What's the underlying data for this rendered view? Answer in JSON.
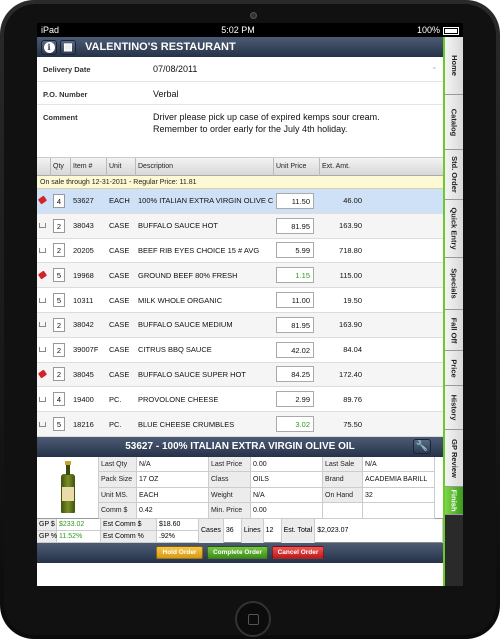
{
  "status_bar": {
    "carrier": "iPad",
    "time": "5:02 PM",
    "battery": "100%"
  },
  "header": {
    "title": "VALENTINO'S RESTAURANT",
    "info_icon": "info-icon",
    "calculator_icon": "calculator-icon"
  },
  "form": {
    "delivery_date_label": "Delivery Date",
    "delivery_date": "07/08/2011",
    "po_label": "P.O. Number",
    "po": "Verbal",
    "comment_label": "Comment",
    "comment": "Driver please pick up case of expired kemps sour cream. Remember to order early for the July 4th holiday."
  },
  "grid": {
    "headers": {
      "qty": "Qty",
      "item": "Item #",
      "unit": "Unit",
      "desc": "Description",
      "price": "Unit Price",
      "ext": "Ext. Amt."
    },
    "on_sale_note": "On sale through 12-31-2011 - Regular Price: 11.81",
    "rows": [
      {
        "icon": "tag",
        "qty": "4",
        "item": "53627",
        "unit": "EACH",
        "desc": "100% ITALIAN EXTRA VIRGIN OLIVE C",
        "price": "11.50",
        "price_green": false,
        "ext": "46.00",
        "selected": true
      },
      {
        "icon": "cart",
        "qty": "2",
        "item": "38043",
        "unit": "CASE",
        "desc": "BUFFALO SAUCE HOT",
        "price": "81.95",
        "price_green": false,
        "ext": "163.90"
      },
      {
        "icon": "cart",
        "qty": "2",
        "item": "20205",
        "unit": "CASE",
        "desc": "BEEF RIB EYES CHOICE 15 # AVG",
        "price": "5.99",
        "price_green": false,
        "ext": "718.80"
      },
      {
        "icon": "tag",
        "qty": "5",
        "item": "19968",
        "unit": "CASE",
        "desc": "GROUND BEEF 80% FRESH",
        "price": "1.15",
        "price_green": true,
        "ext": "115.00"
      },
      {
        "icon": "cart",
        "qty": "5",
        "item": "10311",
        "unit": "CASE",
        "desc": "MILK WHOLE ORGANIC",
        "price": "11.00",
        "price_green": false,
        "ext": "19.50"
      },
      {
        "icon": "cart",
        "qty": "2",
        "item": "38042",
        "unit": "CASE",
        "desc": "BUFFALO SAUCE MEDIUM",
        "price": "81.95",
        "price_green": false,
        "ext": "163.90"
      },
      {
        "icon": "cart",
        "qty": "2",
        "item": "39007F",
        "unit": "CASE",
        "desc": "CITRUS BBQ SAUCE",
        "price": "42.02",
        "price_green": false,
        "ext": "84.04"
      },
      {
        "icon": "tag",
        "qty": "2",
        "item": "38045",
        "unit": "CASE",
        "desc": "BUFFALO SAUCE SUPER HOT",
        "price": "84.25",
        "price_green": false,
        "ext": "172.40"
      },
      {
        "icon": "cart",
        "qty": "4",
        "item": "19400",
        "unit": "PC.",
        "desc": "PROVOLONE CHEESE",
        "price": "2.99",
        "price_green": false,
        "ext": "89.76"
      },
      {
        "icon": "cart",
        "qty": "5",
        "item": "18216",
        "unit": "PC.",
        "desc": "BLUE CHEESE CRUMBLES",
        "price": "3.02",
        "price_green": true,
        "ext": "75.50"
      }
    ]
  },
  "detail": {
    "title": "53627 - 100% ITALIAN EXTRA VIRGIN OLIVE OIL",
    "cells": {
      "last_qty_l": "Last Qty",
      "last_qty": "N/A",
      "last_price_l": "Last Price",
      "last_price": "0.00",
      "last_sale_l": "Last Sale",
      "last_sale": "N/A",
      "pack_l": "Pack Size",
      "pack": "17 OZ",
      "class_l": "Class",
      "class": "OILS",
      "brand_l": "Brand",
      "brand": "ACADEMIA BARILL",
      "unit_l": "Unit MS.",
      "unit": "EACH",
      "weight_l": "Weight",
      "weight": "N/A",
      "onhand_l": "On Hand",
      "onhand": "32",
      "comm_l": "Comm $",
      "comm": "0.42",
      "minprice_l": "Min. Price",
      "minprice": "0.00"
    }
  },
  "summary": {
    "gp_dollar_l": "GP $",
    "gp_dollar": "$233.02",
    "gp_pct_l": "GP %",
    "gp_pct": "11.52%",
    "est_comm_dollar_l": "Est Comm $",
    "est_comm_dollar": "$18.60",
    "est_comm_pct_l": "Est Comm %",
    "est_comm_pct": ".92%",
    "cases_l": "Cases",
    "cases": "36",
    "lines_l": "Lines",
    "lines": "12",
    "est_total_l": "Est. Total",
    "est_total": "$2,023.07"
  },
  "actions": {
    "hold": "Hold Order",
    "complete": "Complete Order",
    "cancel": "Cancel Order"
  },
  "side_tabs": [
    "Home",
    "Catalog",
    "Std. Order",
    "Quick Entry",
    "Specials",
    "Fall Off",
    "Price",
    "History",
    "GP Review",
    "Finish"
  ],
  "colors": {
    "accent": "#6acb2a",
    "header": "#26324a",
    "sale": "#fdf9d4"
  }
}
